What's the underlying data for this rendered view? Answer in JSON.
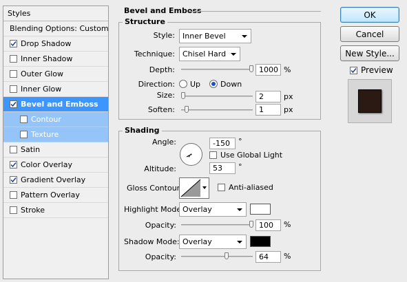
{
  "styles_list": {
    "header": "Styles",
    "items": [
      {
        "label": "Blending Options: Custom",
        "checkbox": false,
        "checked": false,
        "state": "normal"
      },
      {
        "label": "Drop Shadow",
        "checkbox": true,
        "checked": true,
        "state": "normal"
      },
      {
        "label": "Inner Shadow",
        "checkbox": true,
        "checked": false,
        "state": "normal"
      },
      {
        "label": "Outer Glow",
        "checkbox": true,
        "checked": false,
        "state": "normal"
      },
      {
        "label": "Inner Glow",
        "checkbox": true,
        "checked": false,
        "state": "normal"
      },
      {
        "label": "Bevel and Emboss",
        "checkbox": true,
        "checked": true,
        "state": "selected"
      },
      {
        "label": "Contour",
        "checkbox": true,
        "checked": false,
        "state": "sub"
      },
      {
        "label": "Texture",
        "checkbox": true,
        "checked": false,
        "state": "sub"
      },
      {
        "label": "Satin",
        "checkbox": true,
        "checked": false,
        "state": "normal"
      },
      {
        "label": "Color Overlay",
        "checkbox": true,
        "checked": true,
        "state": "normal"
      },
      {
        "label": "Gradient Overlay",
        "checkbox": true,
        "checked": true,
        "state": "normal"
      },
      {
        "label": "Pattern Overlay",
        "checkbox": true,
        "checked": false,
        "state": "normal"
      },
      {
        "label": "Stroke",
        "checkbox": true,
        "checked": false,
        "state": "normal"
      }
    ]
  },
  "bevel": {
    "title": "Bevel and Emboss",
    "structure": {
      "title": "Structure",
      "style_label": "Style:",
      "style_value": "Inner Bevel",
      "technique_label": "Technique:",
      "technique_value": "Chisel Hard",
      "depth_label": "Depth:",
      "depth_value": "1000",
      "depth_unit": "%",
      "depth_level": 1.0,
      "direction_label": "Direction:",
      "direction_up": "Up",
      "direction_down": "Down",
      "direction_selected": "Down",
      "size_label": "Size:",
      "size_value": "2",
      "size_unit": "px",
      "size_level": 0.01,
      "soften_label": "Soften:",
      "soften_value": "1",
      "soften_unit": "px",
      "soften_level": 0.06
    },
    "shading": {
      "title": "Shading",
      "angle_label": "Angle:",
      "angle_value": "-150",
      "angle_unit": "°",
      "use_global_light_label": "Use Global Light",
      "use_global_light": false,
      "altitude_label": "Altitude:",
      "altitude_value": "53",
      "altitude_unit": "°",
      "gloss_contour_label": "Gloss Contour:",
      "anti_aliased_label": "Anti-aliased",
      "anti_aliased": false,
      "highlight_mode_label": "Highlight Mode:",
      "highlight_mode_value": "Overlay",
      "highlight_color": "#ffffff",
      "highlight_opacity_label": "Opacity:",
      "highlight_opacity_value": "100",
      "highlight_opacity_unit": "%",
      "highlight_opacity_level": 1.0,
      "shadow_mode_label": "Shadow Mode:",
      "shadow_mode_value": "Overlay",
      "shadow_color": "#000000",
      "shadow_opacity_label": "Opacity:",
      "shadow_opacity_value": "64",
      "shadow_opacity_unit": "%",
      "shadow_opacity_level": 0.64
    }
  },
  "buttons": {
    "ok": "OK",
    "cancel": "Cancel",
    "new_style": "New Style...",
    "preview_label": "Preview",
    "preview_checked": true
  },
  "colors": {
    "selected_row": "#3d95ff",
    "sub_row": "#95c5f8",
    "preview_fill": "#2b1a14"
  }
}
